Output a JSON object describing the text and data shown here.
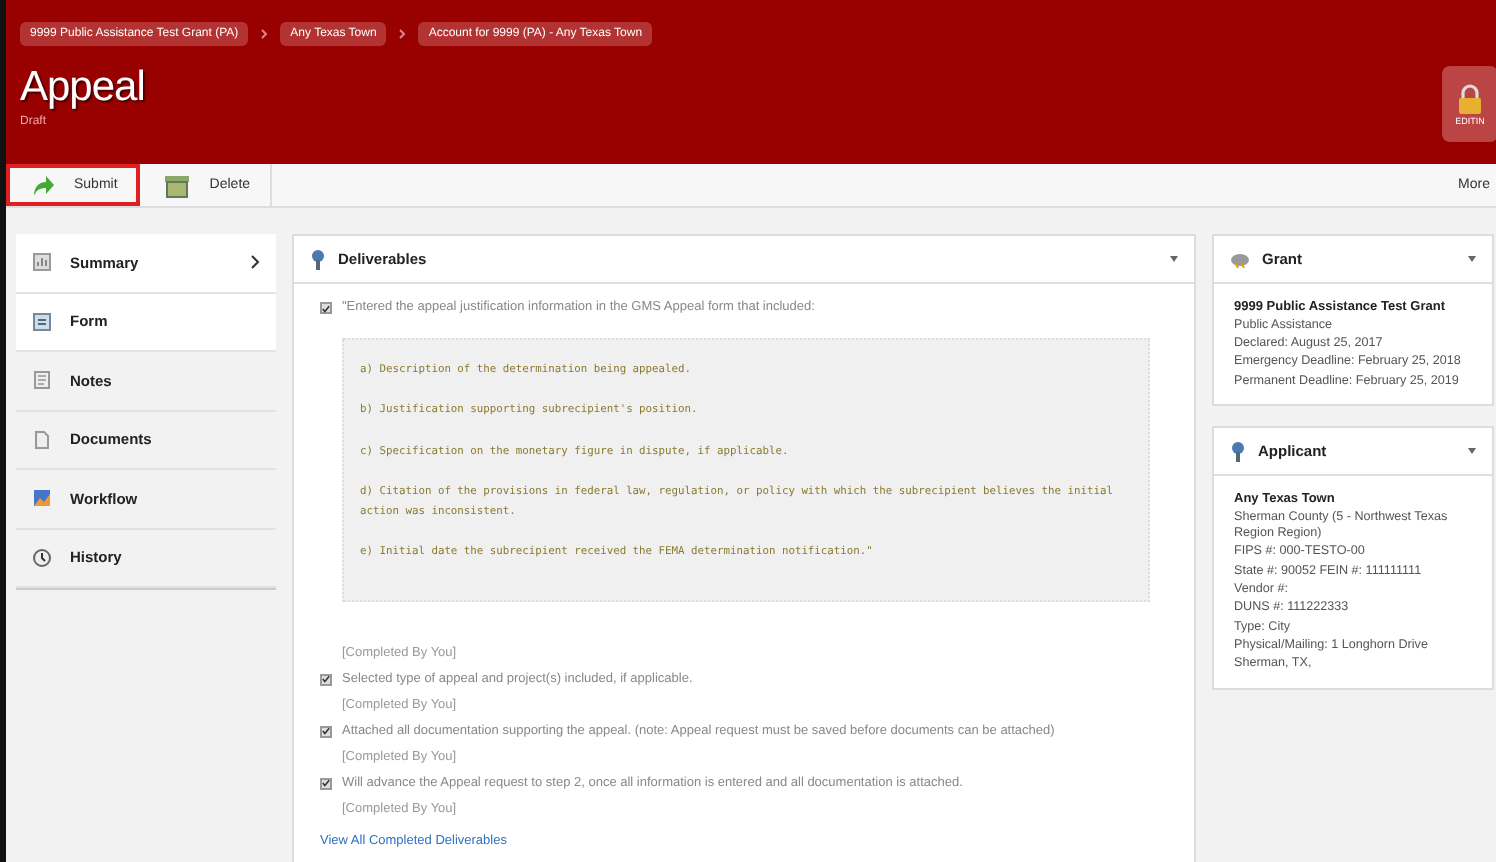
{
  "breadcrumbs": [
    "9999 Public Assistance Test Grant (PA)",
    "Any Texas Town",
    "Account for 9999 (PA) - Any Texas Town"
  ],
  "title": "Appeal",
  "status": "Draft",
  "lock_label": "EDITIN",
  "toolbar": {
    "buttons": [
      {
        "label": "Submit",
        "kind": "submit",
        "outlined": true
      },
      {
        "label": "Delete",
        "kind": "delete",
        "outlined": false
      }
    ],
    "more": "More"
  },
  "sidebar": {
    "items": [
      {
        "label": "Summary",
        "kind": "summary",
        "highlighted": true,
        "expandable": true
      },
      {
        "label": "Form",
        "kind": "form",
        "highlighted": true,
        "expandable": false
      },
      {
        "label": "Notes",
        "kind": "notes",
        "highlighted": false,
        "expandable": false
      },
      {
        "label": "Documents",
        "kind": "documents",
        "highlighted": false,
        "expandable": false
      },
      {
        "label": "Workflow",
        "kind": "workflow",
        "highlighted": false,
        "expandable": false
      },
      {
        "label": "History",
        "kind": "history",
        "highlighted": false,
        "expandable": false
      }
    ]
  },
  "deliverables": {
    "title": "Deliverables",
    "items": [
      {
        "text": "\"Entered the appeal justification information in the GMS Appeal form that included:",
        "checked": true,
        "details": [
          "a)  Description of the determination being appealed.",
          "b)  Justification supporting subrecipient's position.",
          "c)  Specification on the monetary figure in dispute, if applicable.",
          "d)  Citation of the provisions in federal law, regulation, or policy with which the subrecipient believes the initial action was inconsistent.",
          "e)  Initial date the subrecipient received the FEMA determination notification.\""
        ],
        "note": "[Completed By You]"
      },
      {
        "text": "Selected type of appeal and project(s) included, if applicable.",
        "checked": true,
        "note": "[Completed By You]"
      },
      {
        "text": "Attached all documentation supporting the appeal. (note: Appeal request must be saved before documents can be attached)",
        "checked": true,
        "note": "[Completed By You]"
      },
      {
        "text": "Will advance the Appeal request to step 2, once all information is entered and all documentation is attached.",
        "checked": true,
        "note": "[Completed By You]"
      }
    ],
    "link": "View All Completed Deliverables"
  },
  "grant": {
    "title": "Grant",
    "heading": "9999 Public Assistance Test Grant",
    "lines": [
      "Public Assistance",
      "Declared: August 25, 2017",
      "Emergency Deadline: February 25, 2018",
      "Permanent Deadline: February 25, 2019"
    ]
  },
  "applicant": {
    "title": "Applicant",
    "heading": "Any Texas Town",
    "lines": [
      "Sherman County (5 - Northwest Texas Region Region)",
      "FIPS #: 000-TESTO-00",
      "State #: 90052 FEIN #: 111111111",
      "Vendor #:",
      "DUNS #: 111222333",
      "Type: City",
      "Physical/Mailing: 1 Longhorn Drive",
      "Sherman, TX,"
    ]
  }
}
